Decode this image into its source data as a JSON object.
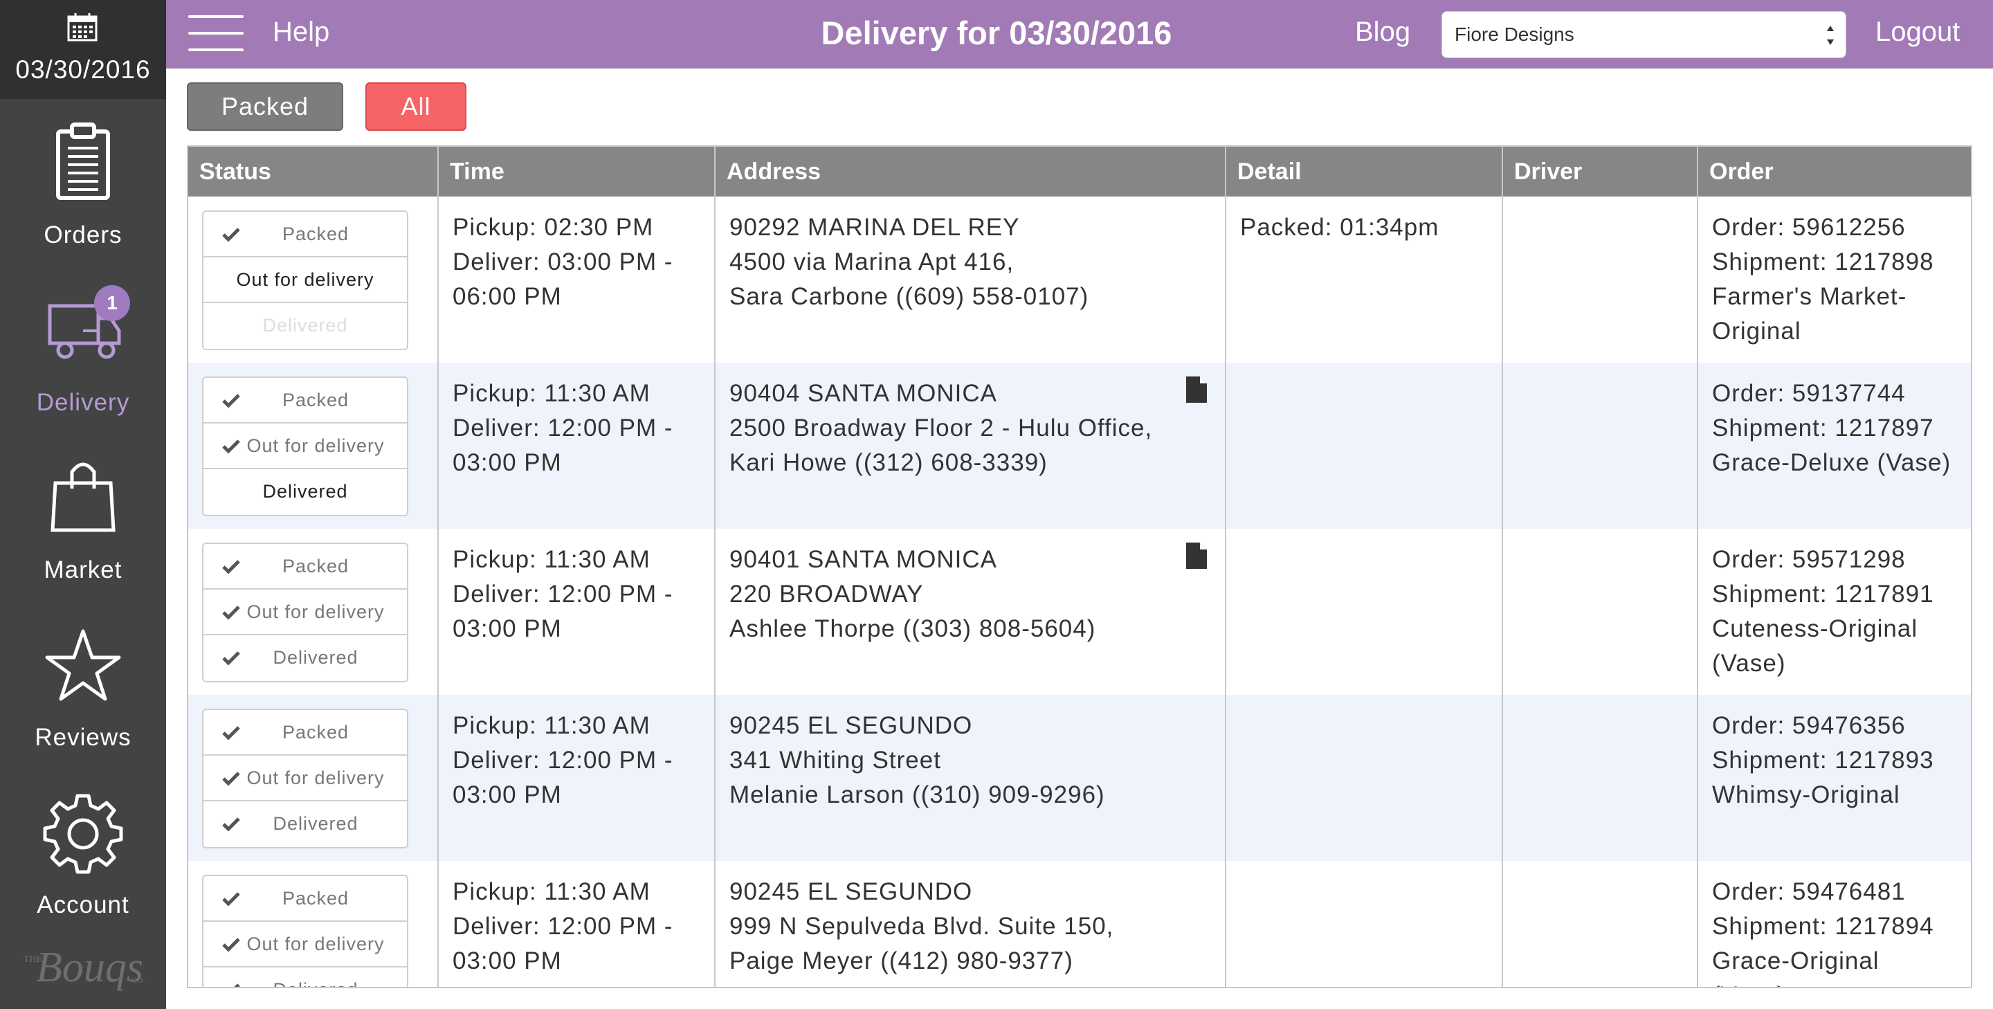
{
  "sidebar": {
    "date": "03/30/2016",
    "items": [
      {
        "label": "Orders",
        "icon": "clipboard-icon"
      },
      {
        "label": "Delivery",
        "icon": "truck-icon",
        "badge": "1"
      },
      {
        "label": "Market",
        "icon": "shopping-bag-icon"
      },
      {
        "label": "Reviews",
        "icon": "star-icon"
      },
      {
        "label": "Account",
        "icon": "gear-icon"
      }
    ],
    "active_color": "#b69ad4"
  },
  "header": {
    "help": "Help",
    "title": "Delivery for 03/30/2016",
    "blog": "Blog",
    "shop": "Fiore Designs",
    "logout": "Logout"
  },
  "filters": {
    "packed": "Packed",
    "all": "All"
  },
  "table": {
    "columns": [
      "Status",
      "Time",
      "Address",
      "Detail",
      "Driver",
      "Order"
    ],
    "status_labels": [
      "Packed",
      "Out for delivery",
      "Delivered"
    ],
    "rows": [
      {
        "status": {
          "packed": true,
          "out": false,
          "delivered": false,
          "active": "out",
          "disabled": "delivered"
        },
        "time": [
          "Pickup: 02:30 PM",
          "Deliver: 03:00 PM -",
          "06:00 PM"
        ],
        "address": [
          "90292 MARINA DEL REY",
          "4500 via Marina Apt 416,",
          "Sara Carbone ((609) 558-0107)"
        ],
        "has_note": false,
        "detail": "Packed: 01:34pm",
        "driver": "",
        "order": [
          "Order: 59612256",
          "Shipment: 1217898",
          "Farmer's Market-",
          "Original"
        ]
      },
      {
        "status": {
          "packed": true,
          "out": true,
          "delivered": false,
          "active": "delivered",
          "disabled": ""
        },
        "time": [
          "Pickup: 11:30 AM",
          "Deliver: 12:00 PM -",
          "03:00 PM"
        ],
        "address": [
          "90404 SANTA MONICA",
          "2500 Broadway Floor 2 - Hulu Office,",
          "Kari Howe ((312) 608-3339)"
        ],
        "has_note": true,
        "detail": "",
        "driver": "",
        "order": [
          "Order: 59137744",
          "Shipment: 1217897",
          "Grace-Deluxe (Vase)"
        ]
      },
      {
        "status": {
          "packed": true,
          "out": true,
          "delivered": true,
          "active": "",
          "disabled": ""
        },
        "time": [
          "Pickup: 11:30 AM",
          "Deliver: 12:00 PM -",
          "03:00 PM"
        ],
        "address": [
          "90401 SANTA MONICA",
          "220 BROADWAY",
          "Ashlee Thorpe ((303) 808-5604)"
        ],
        "has_note": true,
        "detail": "",
        "driver": "",
        "order": [
          "Order: 59571298",
          "Shipment: 1217891",
          "Cuteness-Original",
          "(Vase)"
        ]
      },
      {
        "status": {
          "packed": true,
          "out": true,
          "delivered": true,
          "active": "",
          "disabled": ""
        },
        "time": [
          "Pickup: 11:30 AM",
          "Deliver: 12:00 PM -",
          "03:00 PM"
        ],
        "address": [
          "90245 EL SEGUNDO",
          "341 Whiting Street",
          "Melanie Larson ((310) 909-9296)"
        ],
        "has_note": false,
        "detail": "",
        "driver": "",
        "order": [
          "Order: 59476356",
          "Shipment: 1217893",
          "Whimsy-Original"
        ]
      },
      {
        "status": {
          "packed": true,
          "out": true,
          "delivered": true,
          "active": "",
          "disabled": ""
        },
        "time": [
          "Pickup: 11:30 AM",
          "Deliver: 12:00 PM -",
          "03:00 PM"
        ],
        "address": [
          "90245 EL SEGUNDO",
          "999 N Sepulveda Blvd. Suite 150,",
          "Paige Meyer ((412) 980-9377)"
        ],
        "has_note": false,
        "detail": "",
        "driver": "",
        "order": [
          "Order: 59476481",
          "Shipment: 1217894",
          "Grace-Original",
          "(Vase)"
        ]
      }
    ]
  },
  "logo_text": "THE Bouqs CO."
}
